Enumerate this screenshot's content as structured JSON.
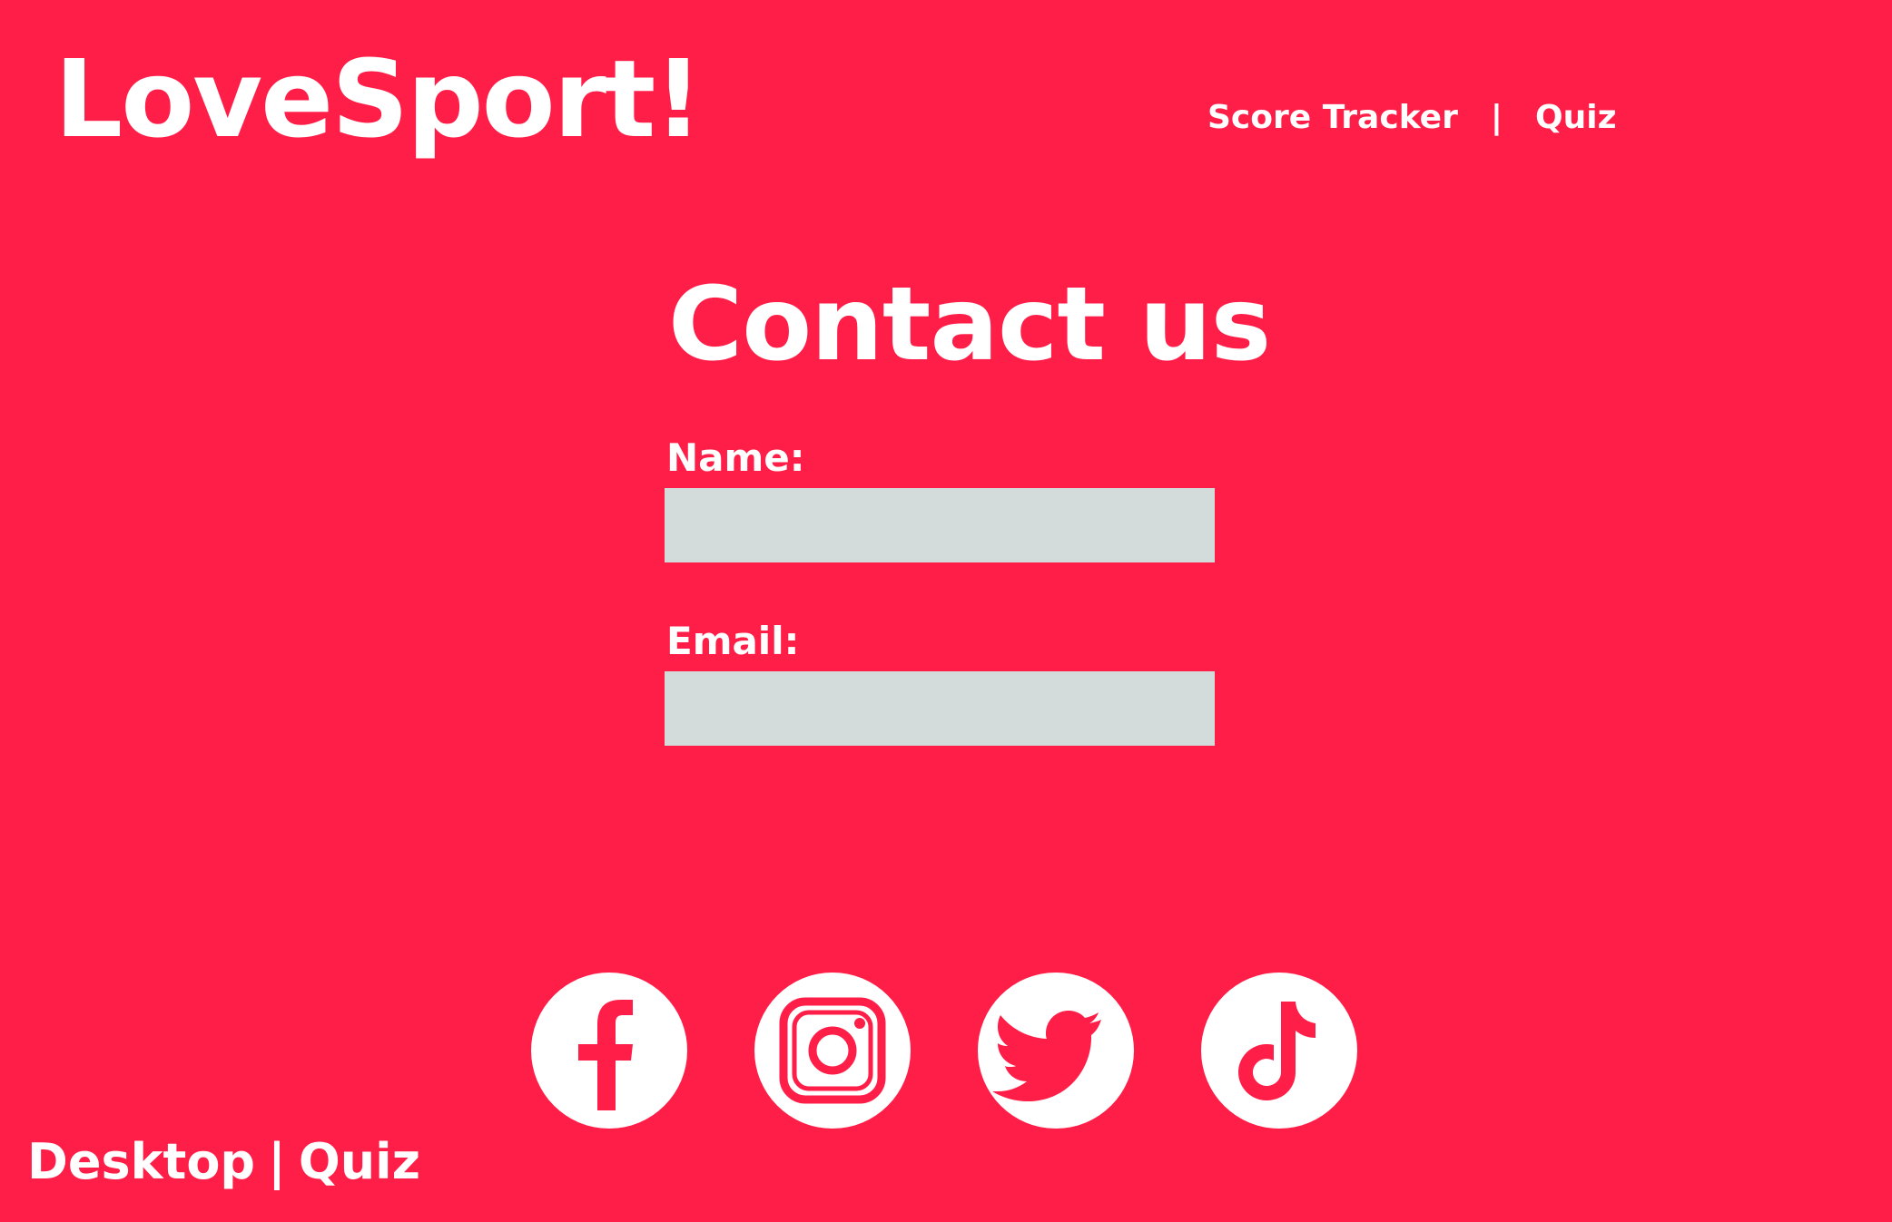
{
  "header": {
    "logo_text": "LoveSport!",
    "nav": {
      "score_tracker": "Score Tracker",
      "separator": "|",
      "quiz": "Quiz"
    }
  },
  "contact": {
    "title": "Contact us",
    "name_label": "Name:",
    "name_value": "",
    "email_label": "Email:",
    "email_value": ""
  },
  "socials": [
    {
      "icon": "facebook-icon"
    },
    {
      "icon": "instagram-icon"
    },
    {
      "icon": "twitter-icon"
    },
    {
      "icon": "tiktok-icon"
    }
  ],
  "footer": {
    "platform": "Desktop",
    "separator": "|",
    "page": "Quiz"
  },
  "colors": {
    "background": "#ff1e48",
    "text": "#ffffff",
    "input_fill": "#d3dcda"
  }
}
